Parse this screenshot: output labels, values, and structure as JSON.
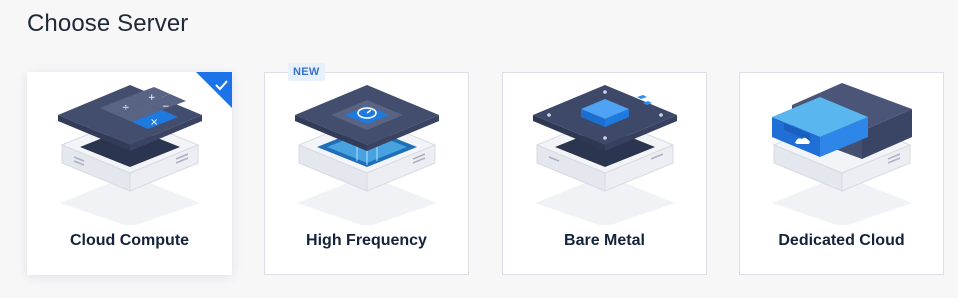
{
  "page": {
    "title": "Choose Server"
  },
  "cards": [
    {
      "label": "Cloud Compute",
      "selected": true,
      "icon": "calculator-chip-icon"
    },
    {
      "label": "High Frequency",
      "badge": "NEW",
      "icon": "speedometer-chip-icon"
    },
    {
      "label": "Bare Metal",
      "icon": "processor-board-icon"
    },
    {
      "label": "Dedicated Cloud",
      "icon": "dedicated-cloud-block-icon"
    }
  ],
  "colors": {
    "accent": "#1a73e8",
    "card_border": "#dcdfe5",
    "label_text": "#14233b",
    "badge_bg": "#e7f0fd",
    "badge_text": "#3a71c9"
  }
}
